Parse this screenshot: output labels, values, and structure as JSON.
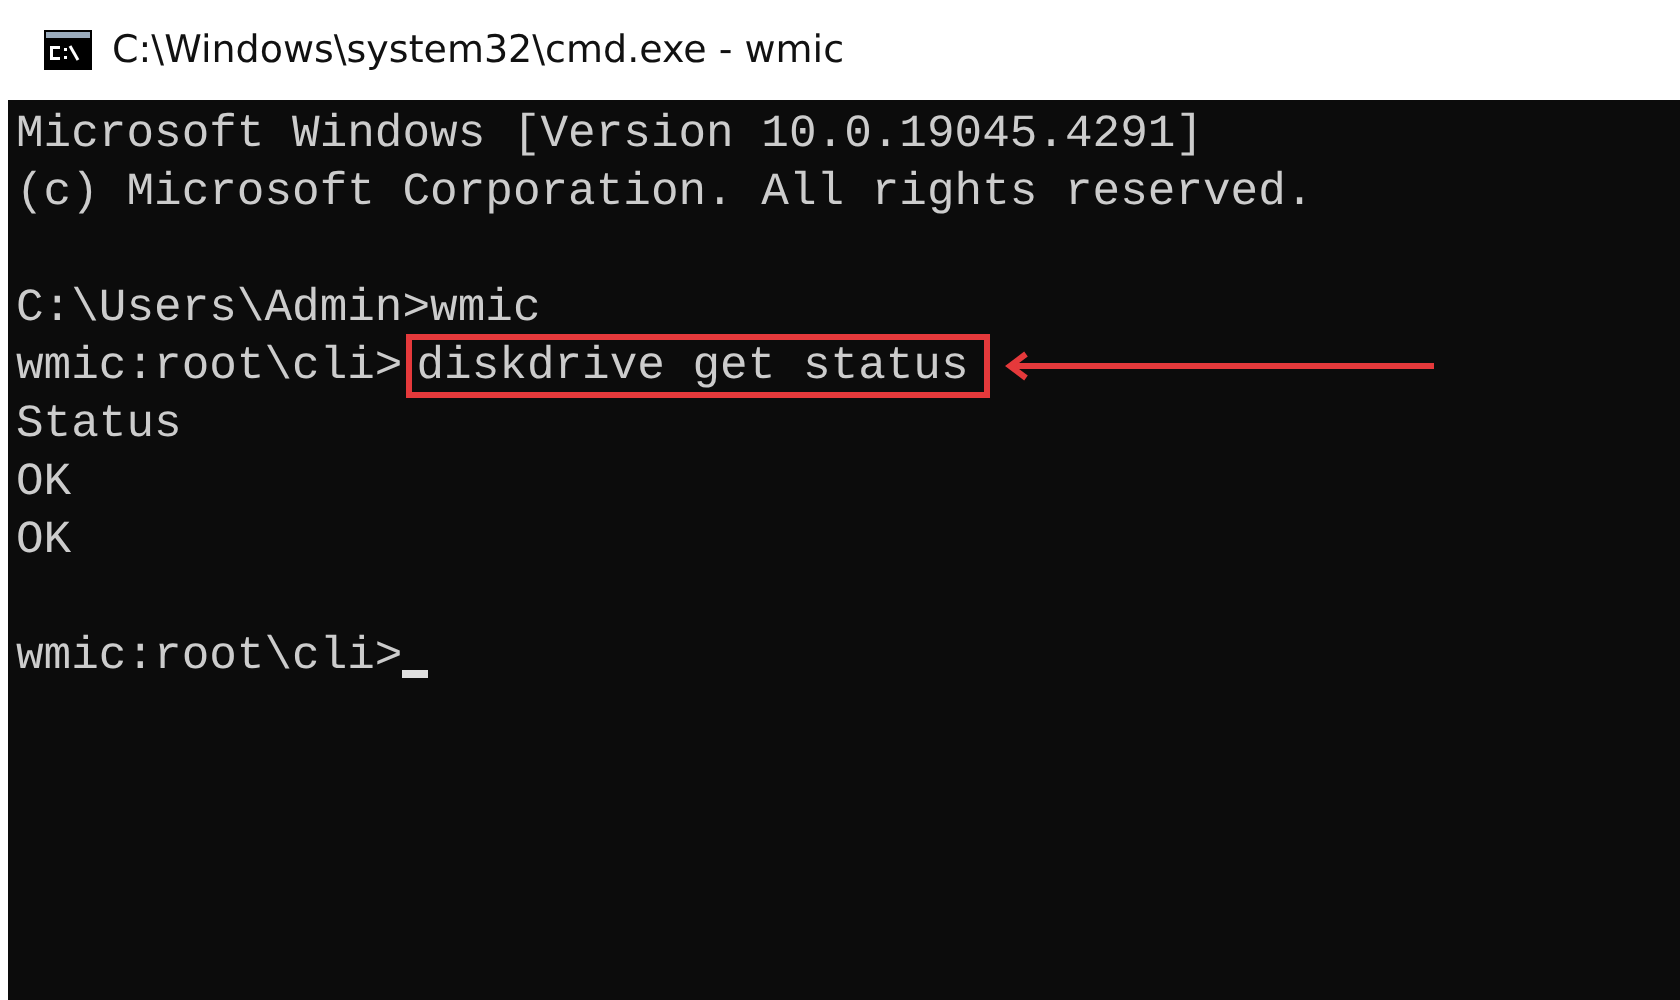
{
  "window": {
    "title": "C:\\Windows\\system32\\cmd.exe - wmic"
  },
  "console": {
    "lines": [
      {
        "kind": "output",
        "text": "Microsoft Windows [Version 10.0.19045.4291]"
      },
      {
        "kind": "output",
        "text": "(c) Microsoft Corporation. All rights reserved."
      },
      {
        "kind": "blank"
      },
      {
        "kind": "output",
        "text": "C:\\Users\\Admin>wmic"
      },
      {
        "kind": "input",
        "prompt": "wmic:root\\cli>",
        "command": "diskdrive get status",
        "highlighted": true
      },
      {
        "kind": "output",
        "text": "Status"
      },
      {
        "kind": "output",
        "text": "OK"
      },
      {
        "kind": "output",
        "text": "OK"
      },
      {
        "kind": "blank"
      },
      {
        "kind": "input",
        "prompt": "wmic:root\\cli>",
        "cursor": true
      }
    ]
  }
}
